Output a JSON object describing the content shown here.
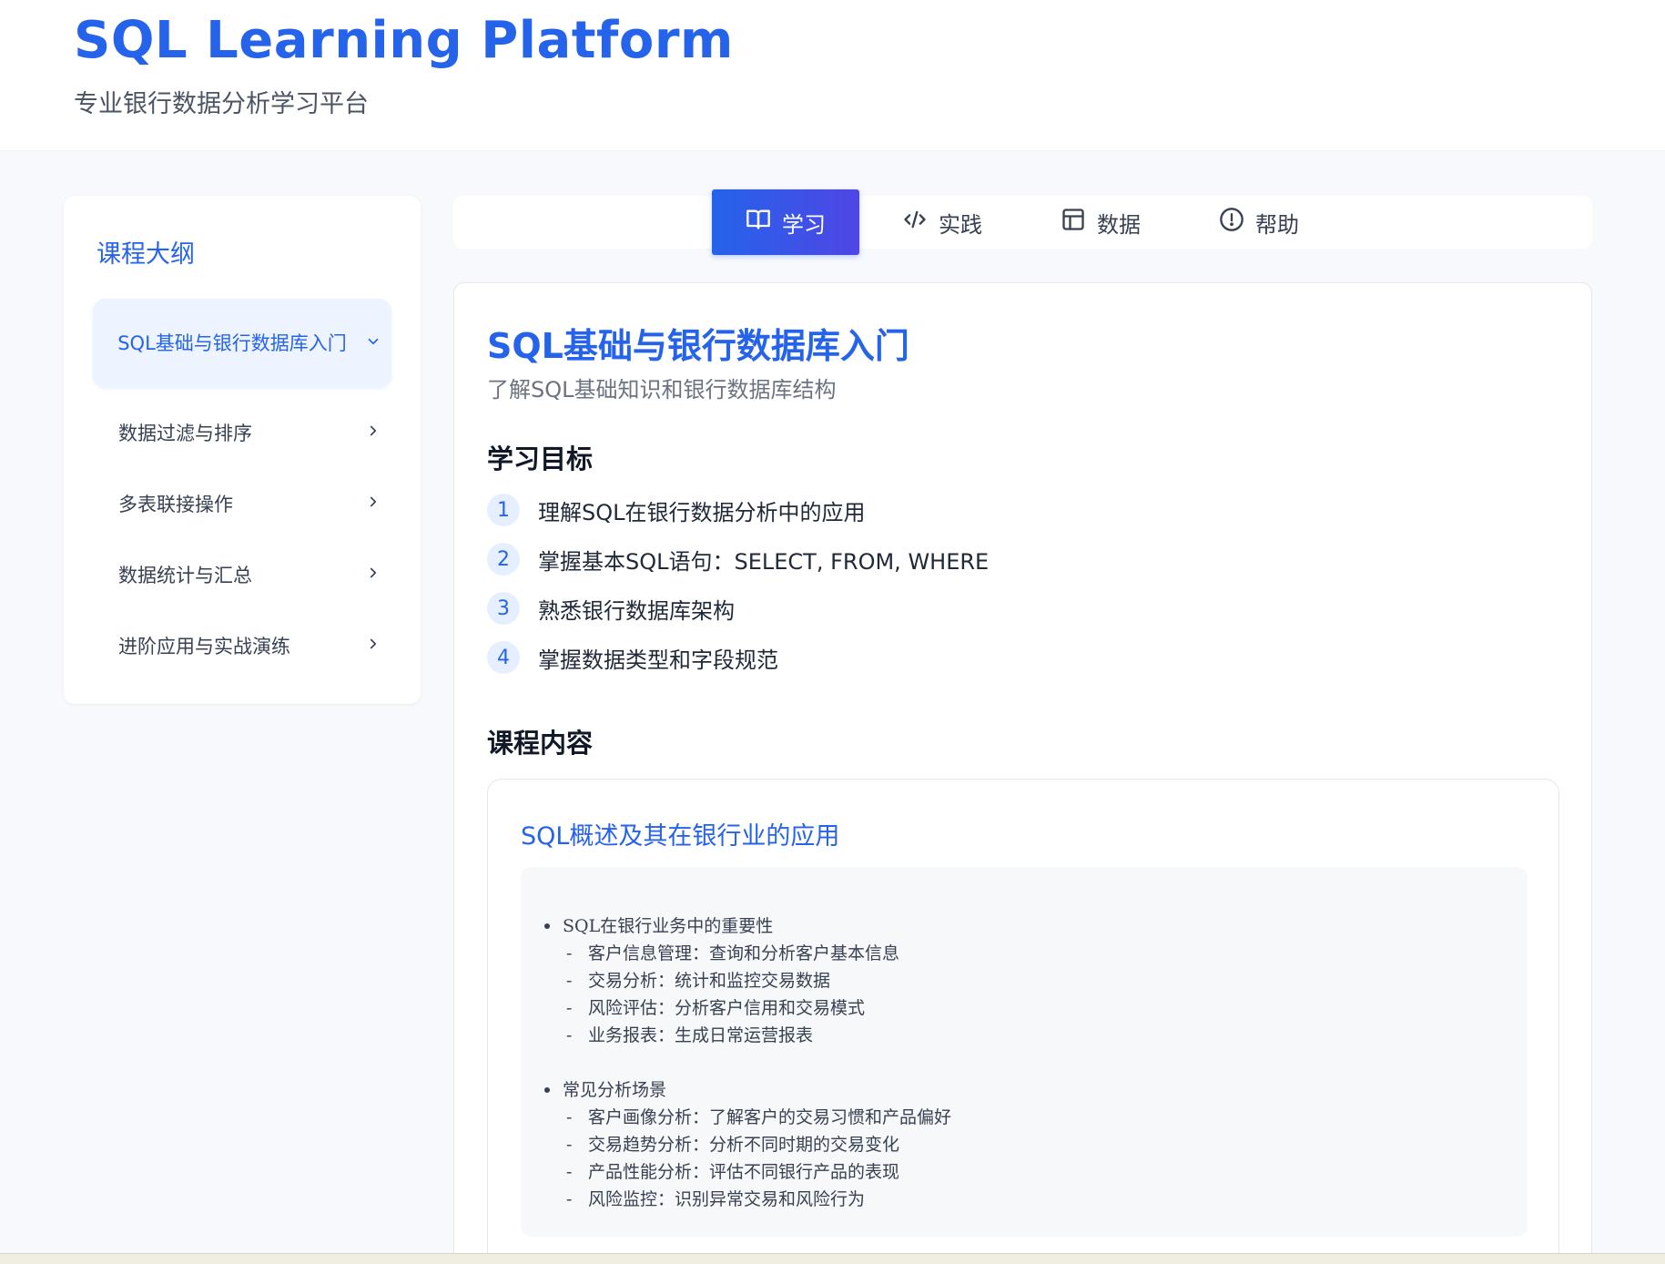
{
  "header": {
    "title": "SQL Learning Platform",
    "subtitle": "专业银行数据分析学习平台"
  },
  "sidebar": {
    "title": "课程大纲",
    "items": [
      {
        "label": "SQL基础与银行数据库入门",
        "active": true,
        "icon": "chevron-down-icon"
      },
      {
        "label": "数据过滤与排序",
        "active": false,
        "icon": "chevron-right-icon"
      },
      {
        "label": "多表联接操作",
        "active": false,
        "icon": "chevron-right-icon"
      },
      {
        "label": "数据统计与汇总",
        "active": false,
        "icon": "chevron-right-icon"
      },
      {
        "label": "进阶应用与实战演练",
        "active": false,
        "icon": "chevron-right-icon"
      }
    ]
  },
  "tabs": [
    {
      "label": "学习",
      "icon": "book-icon",
      "active": true
    },
    {
      "label": "实践",
      "icon": "code-icon",
      "active": false
    },
    {
      "label": "数据",
      "icon": "table-icon",
      "active": false
    },
    {
      "label": "帮助",
      "icon": "alert-circle-icon",
      "active": false
    }
  ],
  "lesson": {
    "title": "SQL基础与银行数据库入门",
    "subtitle": "了解SQL基础知识和银行数据库结构",
    "objectives_heading": "学习目标",
    "objectives": [
      {
        "num": "1",
        "text": "理解SQL在银行数据分析中的应用"
      },
      {
        "num": "2",
        "text": "掌握基本SQL语句：SELECT, FROM, WHERE"
      },
      {
        "num": "3",
        "text": "熟悉银行数据库架构"
      },
      {
        "num": "4",
        "text": "掌握数据类型和字段规范"
      }
    ],
    "content_heading": "课程内容",
    "content_card": {
      "title": "SQL概述及其在银行业的应用",
      "groups": [
        {
          "heading": "SQL在银行业务中的重要性",
          "items": [
            "客户信息管理：查询和分析客户基本信息",
            "交易分析：统计和监控交易数据",
            "风险评估：分析客户信用和交易模式",
            "业务报表：生成日常运营报表"
          ]
        },
        {
          "heading": "常见分析场景",
          "items": [
            "客户画像分析：了解客户的交易习惯和产品偏好",
            "交易趋势分析：分析不同时期的交易变化",
            "产品性能分析：评估不同银行产品的表现",
            "风险监控：识别异常交易和风险行为"
          ]
        }
      ]
    }
  },
  "colors": {
    "accent": "#2563eb",
    "accent_gradient_end": "#4f46e5",
    "page_bg": "#f7f9fc"
  }
}
